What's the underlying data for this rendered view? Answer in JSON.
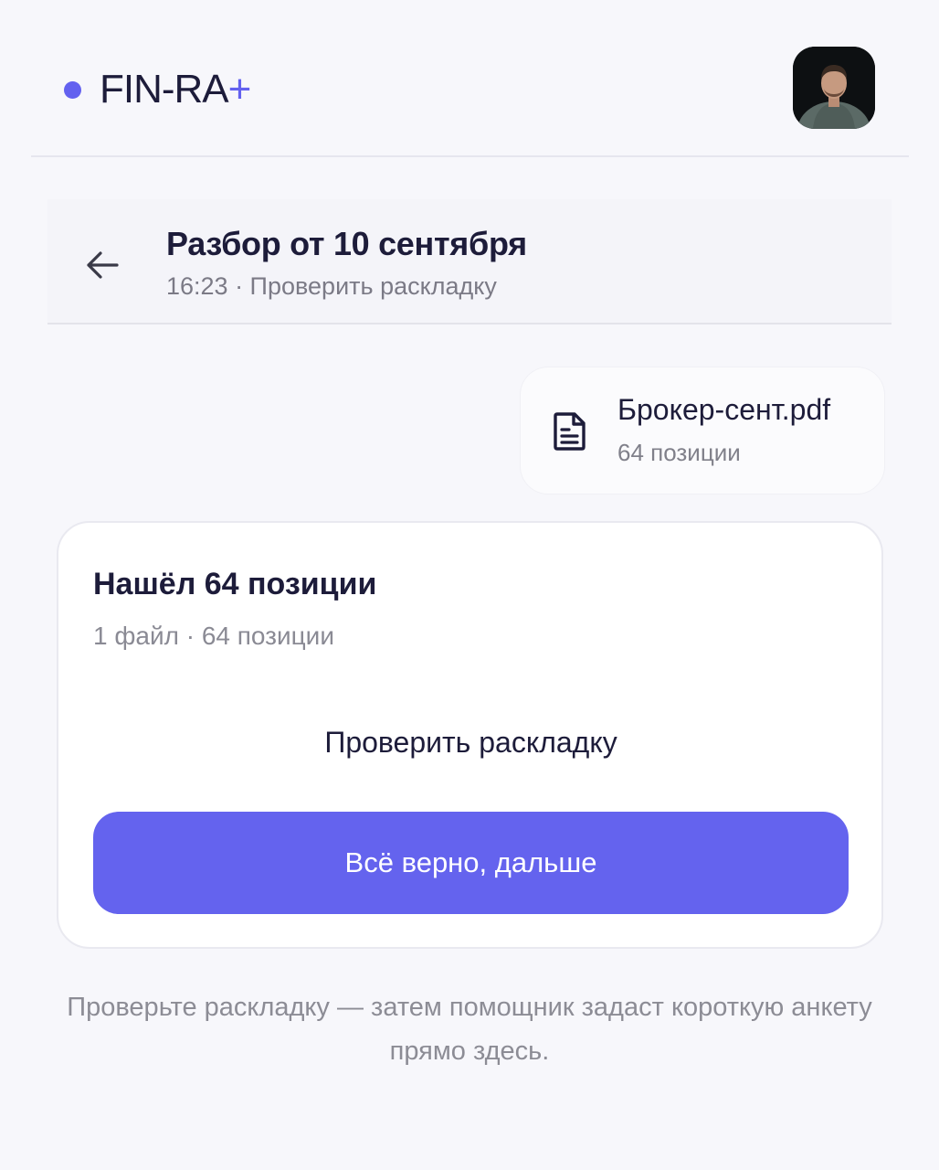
{
  "header": {
    "brand_name": "FIN-RA",
    "brand_plus": "+",
    "avatar": "user-avatar-photo"
  },
  "thread": {
    "title": "Разбор от 10 сентября",
    "meta": "16:23 · Проверить раскладку"
  },
  "file": {
    "icon": "document-icon",
    "name": "Брокер-сент.pdf",
    "count": "64 позиции"
  },
  "result": {
    "title": "Нашёл 64 позиции",
    "subtitle": "1 файл · 64 позиции",
    "check_label": "Проверить раскладку",
    "confirm_label": "Всё верно, дальше"
  },
  "footnote": "Проверьте раскладку — затем помощник задаст короткую анкету прямо здесь.",
  "colors": {
    "accent": "#6463ee",
    "background": "#f7f7fb",
    "text": "#1d1c3a",
    "muted": "#8a8a94"
  }
}
